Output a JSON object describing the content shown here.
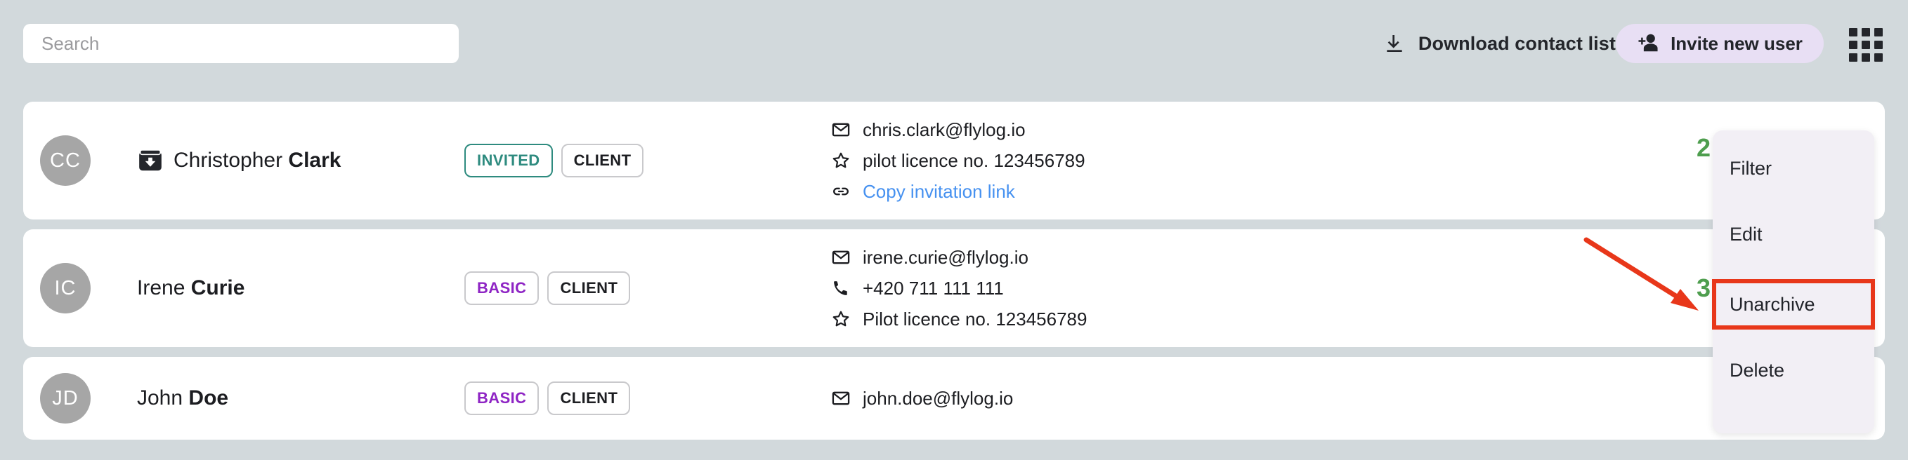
{
  "toolbar": {
    "search_placeholder": "Search",
    "search_value": "",
    "download_label": "Download contact list",
    "download_icon": "download-icon",
    "invite_label": "Invite new user",
    "invite_icon": "person-add-icon",
    "grid_icon": "apps-grid-icon",
    "invite_bg_color": "#e8dff4"
  },
  "contacts": [
    {
      "initials": "CC",
      "first_name": "Christopher",
      "last_name": "Clark",
      "archived": true,
      "archive_icon": "archive-icon",
      "badges": [
        {
          "label": "INVITED",
          "style": "invited",
          "color": "#2e8b7f"
        },
        {
          "label": "CLIENT",
          "style": "default",
          "color": "#1c1d21"
        }
      ],
      "details": [
        {
          "icon": "email-icon",
          "text": "chris.clark@flylog.io",
          "link": false
        },
        {
          "icon": "star-icon",
          "text": "pilot licence no. 123456789",
          "link": false
        },
        {
          "icon": "link-icon",
          "text": "Copy invitation link",
          "link": true,
          "color": "#4691f0"
        }
      ]
    },
    {
      "initials": "IC",
      "first_name": "Irene",
      "last_name": "Curie",
      "archived": false,
      "badges": [
        {
          "label": "BASIC",
          "style": "basic",
          "color": "#8e24c4"
        },
        {
          "label": "CLIENT",
          "style": "default",
          "color": "#1c1d21"
        }
      ],
      "details": [
        {
          "icon": "email-icon",
          "text": "irene.curie@flylog.io",
          "link": false
        },
        {
          "icon": "phone-icon",
          "text": "+420 711 111 111",
          "link": false
        },
        {
          "icon": "star-icon",
          "text": "Pilot licence no. 123456789",
          "link": false
        }
      ]
    },
    {
      "initials": "JD",
      "first_name": "John",
      "last_name": "Doe",
      "archived": false,
      "badges": [
        {
          "label": "BASIC",
          "style": "basic",
          "color": "#8e24c4"
        },
        {
          "label": "CLIENT",
          "style": "default",
          "color": "#1c1d21"
        }
      ],
      "details": [
        {
          "icon": "email-icon",
          "text": "john.doe@flylog.io",
          "link": false
        }
      ]
    }
  ],
  "dropdown_menu": {
    "items": [
      {
        "label": "Filter",
        "highlighted": false
      },
      {
        "label": "Edit",
        "highlighted": false
      },
      {
        "label": "Unarchive",
        "highlighted": true
      },
      {
        "label": "Delete",
        "highlighted": false
      }
    ],
    "background_color": "#f2eff5"
  },
  "annotations": {
    "step_markers": [
      {
        "number": "2"
      },
      {
        "number": "3"
      }
    ],
    "highlight_color": "#e8371a",
    "marker_color": "#4e9e4e"
  }
}
